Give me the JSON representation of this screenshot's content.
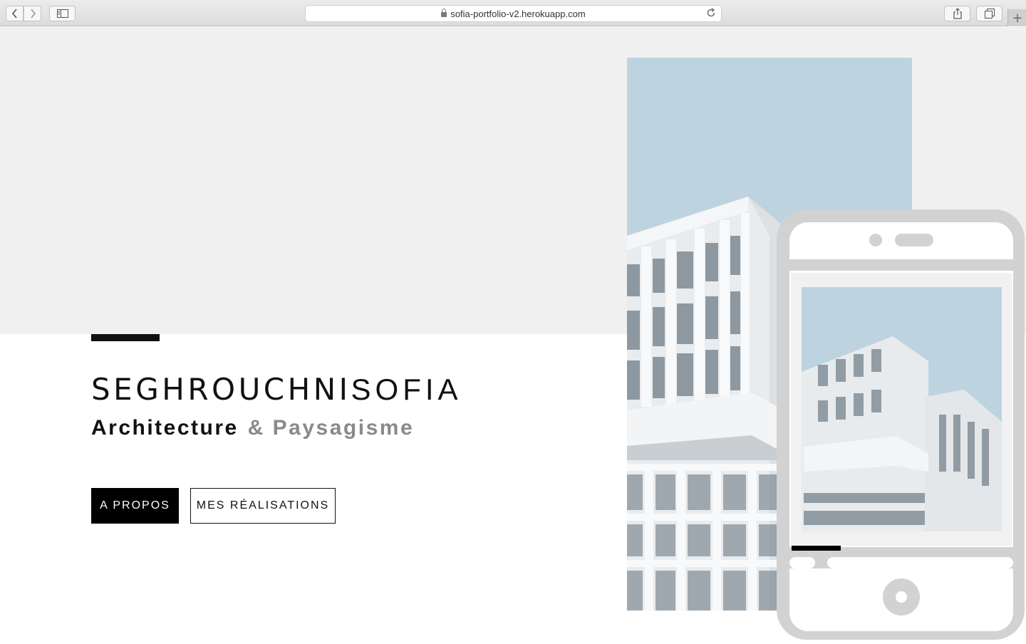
{
  "browser": {
    "url": "sofia-portfolio-v2.herokuapp.com",
    "icons": {
      "back": "chevron-left-icon",
      "forward": "chevron-right-icon",
      "sidebar": "sidebar-icon",
      "share": "share-icon",
      "tabs": "tabs-overview-icon",
      "new_tab": "plus-icon",
      "lock": "lock-icon",
      "reload": "reload-icon"
    },
    "new_tab_label": "+"
  },
  "hero": {
    "title_bold": "SEGHROUCHNI",
    "title_light": "SOFIA",
    "subtitle_main": "Architecture",
    "subtitle_rest": "& Paysagisme",
    "buttons": {
      "about": "A PROPOS",
      "works": "MES RÉALISATIONS"
    }
  },
  "colors": {
    "hero_background": "#f0f0f0",
    "accent": "#111111",
    "sky": "#bed3e0",
    "phone_frame": "#d2d2d2"
  }
}
